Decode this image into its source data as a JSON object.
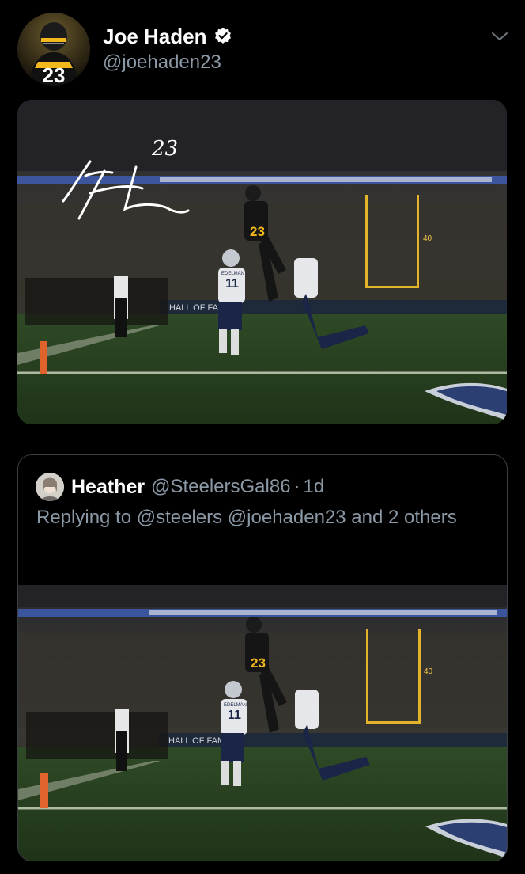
{
  "author": {
    "name": "Joe Haden",
    "handle": "@joehaden23",
    "verified": true,
    "avatar_number": "23"
  },
  "media": {
    "signature_number": "23",
    "yard_marker": "40",
    "sideline_banner": "HALL OF FAME",
    "jersey_number_defender": "23",
    "jersey_number_receiver": "11",
    "receiver_nameplate": "EDELMAN"
  },
  "quoted_tweet": {
    "name": "Heather",
    "handle": "@SteelersGal86",
    "separator": "·",
    "time": "1d",
    "reply_text": "Replying to @steelers @joehaden23 and 2 others"
  },
  "colors": {
    "background": "#000000",
    "muted_text": "#8b98a5",
    "border": "#3a3f44"
  },
  "icons": {
    "verified": "verified-badge-icon",
    "menu": "chevron-down-icon"
  }
}
